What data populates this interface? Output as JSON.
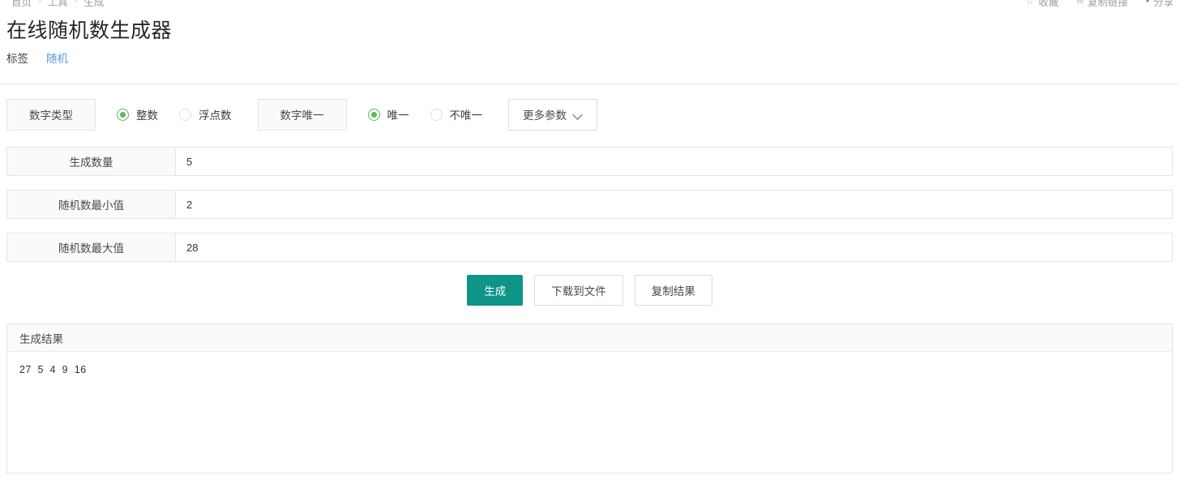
{
  "breadcrumb": {
    "items": [
      "首页",
      "工具",
      "生成"
    ],
    "separator": "›"
  },
  "top_actions": [
    {
      "icon": "bookmark-icon",
      "glyph": "☆",
      "label": "收藏"
    },
    {
      "icon": "link-icon",
      "glyph": "∞",
      "label": "复制链接"
    },
    {
      "icon": "share-icon",
      "glyph": "•",
      "label": "分享"
    }
  ],
  "page_title": "在线随机数生成器",
  "tags": {
    "label": "标签",
    "links": [
      "随机"
    ]
  },
  "options": {
    "number_type": {
      "label": "数字类型",
      "choices": [
        {
          "label": "整数",
          "selected": true
        },
        {
          "label": "浮点数",
          "selected": false
        }
      ]
    },
    "uniqueness": {
      "label": "数字唯一",
      "choices": [
        {
          "label": "唯一",
          "selected": true
        },
        {
          "label": "不唯一",
          "selected": false
        }
      ]
    },
    "more_params_label": "更多参数"
  },
  "fields": [
    {
      "label": "生成数量",
      "value": "5"
    },
    {
      "label": "随机数最小值",
      "value": "2"
    },
    {
      "label": "随机数最大值",
      "value": "28"
    }
  ],
  "buttons": {
    "generate": "生成",
    "download": "下载到文件",
    "copy": "复制结果"
  },
  "result": {
    "header": "生成结果",
    "values": [
      "27",
      "5",
      "4",
      "9",
      "16"
    ],
    "text": "27  5  4  9  16"
  },
  "colors": {
    "primary": "#0f9488",
    "radio_green": "#5cb85c",
    "link_blue": "#5b9bd5",
    "border": "#e6e6e6",
    "panel_bg": "#fafafa"
  }
}
